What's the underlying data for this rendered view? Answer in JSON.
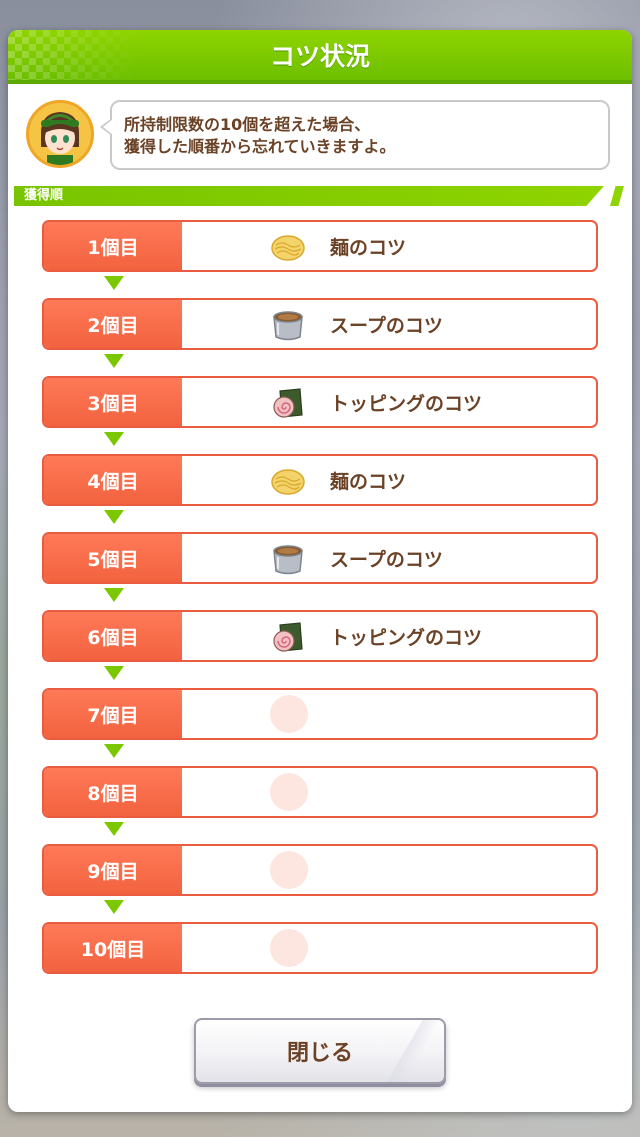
{
  "dialog": {
    "title": "コツ状況",
    "message_line1": "所持制限数の10個を超えた場合、",
    "message_line2": "獲得した順番から忘れていきますよ。",
    "section_label": "獲得順",
    "close_label": "閉じる"
  },
  "slots": [
    {
      "label": "1個目",
      "item": "麺のコツ",
      "icon": "noodle-icon"
    },
    {
      "label": "2個目",
      "item": "スープのコツ",
      "icon": "soup-pot-icon"
    },
    {
      "label": "3個目",
      "item": "トッピングのコツ",
      "icon": "topping-icon"
    },
    {
      "label": "4個目",
      "item": "麺のコツ",
      "icon": "noodle-icon"
    },
    {
      "label": "5個目",
      "item": "スープのコツ",
      "icon": "soup-pot-icon"
    },
    {
      "label": "6個目",
      "item": "トッピングのコツ",
      "icon": "topping-icon"
    },
    {
      "label": "7個目",
      "item": "",
      "icon": "empty-slot-icon"
    },
    {
      "label": "8個目",
      "item": "",
      "icon": "empty-slot-icon"
    },
    {
      "label": "9個目",
      "item": "",
      "icon": "empty-slot-icon"
    },
    {
      "label": "10個目",
      "item": "",
      "icon": "empty-slot-icon"
    }
  ],
  "colors": {
    "header_green": "#8fd400",
    "slot_red": "#f2623f",
    "text_brown": "#6b4226",
    "arrow_green": "#7cc800"
  }
}
